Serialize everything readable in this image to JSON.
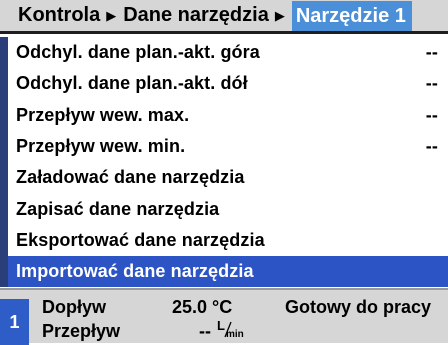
{
  "breadcrumb": {
    "items": [
      "Kontrola",
      "Dane narzędzia"
    ],
    "active": "Narzędzie 1",
    "separator_icon": "triangle-right-icon"
  },
  "menu": {
    "items": [
      {
        "label": "Odchyl. dane plan.-akt. góra",
        "value": "--"
      },
      {
        "label": "Odchyl. dane plan.-akt. dół",
        "value": "--"
      },
      {
        "label": "Przepływ wew. max.",
        "value": "--"
      },
      {
        "label": "Przepływ wew. min.",
        "value": "--"
      },
      {
        "label": "Załadować dane narzędzia",
        "value": ""
      },
      {
        "label": "Zapisać dane narzędzia",
        "value": ""
      },
      {
        "label": "Eksportować dane narzędzia",
        "value": ""
      },
      {
        "label": "Importować dane narzędzia",
        "value": ""
      }
    ],
    "selected_index": 7
  },
  "status": {
    "tool_number": "1",
    "inflow_label": "Dopływ",
    "inflow_value": "25.0 °C",
    "flow_label": "Przepływ",
    "flow_value": "--",
    "flow_unit_num": "L",
    "flow_unit_den": "min",
    "state": "Gotowy do pracy"
  },
  "colors": {
    "header_bg": "#d6d6d6",
    "active_crumb": "#4a8fd8",
    "selection": "#2c54c4",
    "tool_badge": "#2f5dc7"
  }
}
